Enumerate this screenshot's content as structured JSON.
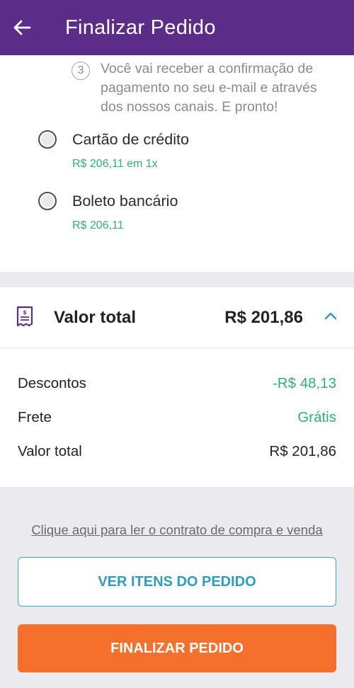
{
  "header": {
    "title": "Finalizar Pedido",
    "back_icon": "arrow-left-icon",
    "background": "#5b2d88"
  },
  "payment": {
    "step_number": "3",
    "step_text": "Você vai receber a confirmação de pagamento no seu e-mail e através dos nossos canais. E pronto!",
    "options": [
      {
        "label": "Cartão de crédito",
        "price": "R$ 206,11 em 1x",
        "selected": false
      },
      {
        "label": "Boleto bancário",
        "price": "R$ 206,11",
        "selected": false
      }
    ]
  },
  "total": {
    "icon": "receipt-icon",
    "label": "Valor total",
    "value": "R$ 201,86",
    "expanded": true,
    "rows": [
      {
        "label": "Descontos",
        "value": "-R$ 48,13"
      },
      {
        "label": "Frete",
        "value": "Grátis"
      },
      {
        "label": "Valor total",
        "value": "R$ 201,86"
      }
    ]
  },
  "footer": {
    "contract_link": "Clique aqui para ler o contrato de compra e venda",
    "view_items_button": "VER ITENS DO PEDIDO",
    "checkout_button": "FINALIZAR PEDIDO"
  },
  "colors": {
    "accent_purple": "#5b2d88",
    "green": "#2db27d",
    "blue": "#2f9cc0",
    "orange": "#f4702c"
  }
}
